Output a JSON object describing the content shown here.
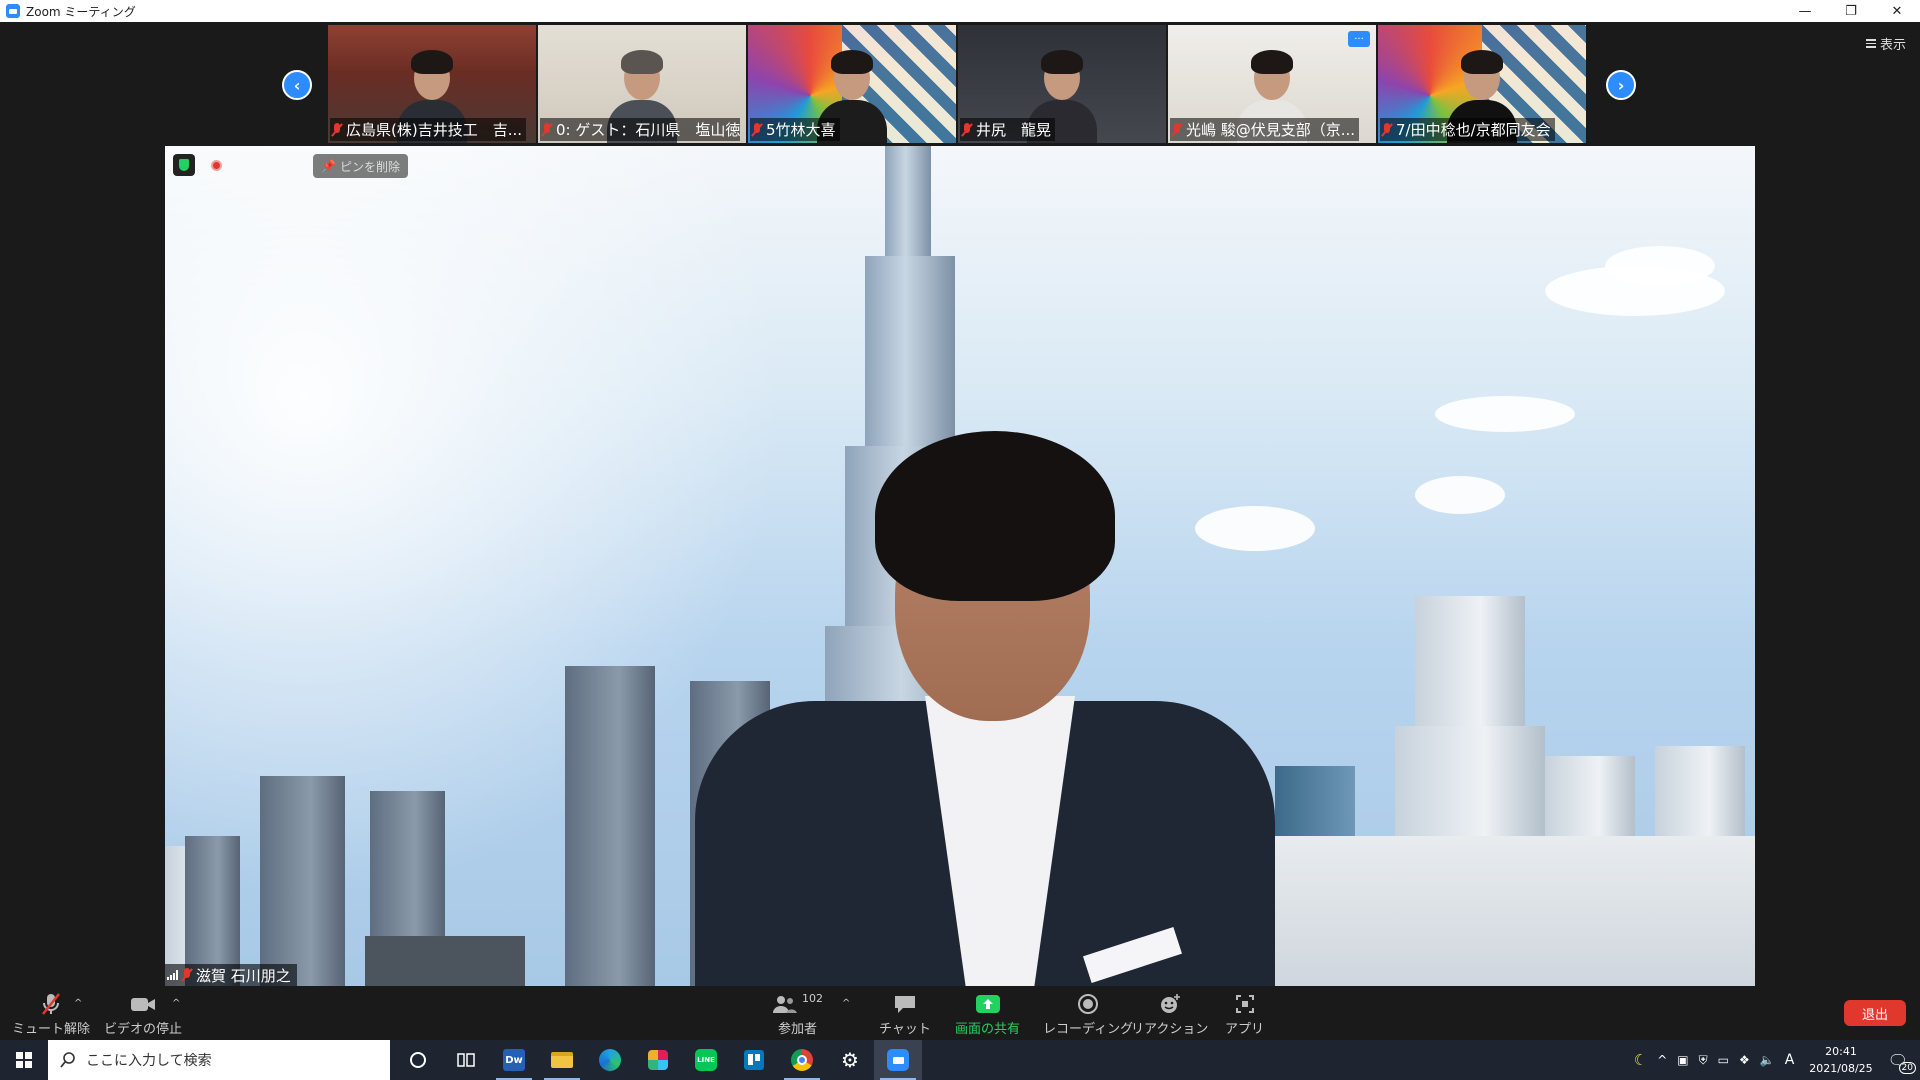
{
  "window": {
    "title": "Zoom ミーティング"
  },
  "gallery": {
    "participants": [
      {
        "name": "広島県(株)吉井技工　吉...",
        "bg": "#7a3a2e"
      },
      {
        "name": "0: ゲスト：石川県　塩山徳...",
        "bg": "#d8d2c8"
      },
      {
        "name": "5竹林大喜",
        "bg": "#e8e4dc"
      },
      {
        "name": "井尻　龍晃",
        "bg": "#3a3d44"
      },
      {
        "name": "光嶋 駿@伏見支部（京...",
        "bg": "#e6e3de"
      },
      {
        "name": "7/田中稔也/京都同友会",
        "bg": "#ece9e2"
      }
    ],
    "more_label": "···",
    "view_label": "表示"
  },
  "main": {
    "speaker_name": "滋賀 石川朋之",
    "pin_label": "ピンを削除"
  },
  "toolbar": {
    "unmute": "ミュート解除",
    "stop_video": "ビデオの停止",
    "participants": "参加者",
    "participants_count": "102",
    "chat": "チャット",
    "share": "画面の共有",
    "record": "レコーディング",
    "reactions": "リアクション",
    "apps": "アプリ",
    "leave": "退出"
  },
  "taskbar": {
    "search_placeholder": "ここに入力して検索",
    "time": "20:41",
    "date": "2021/08/25",
    "ime": "A",
    "notifications": "20"
  },
  "colors": {
    "accent": "#2d8cff",
    "danger": "#e0382d",
    "share_green": "#23d160"
  }
}
